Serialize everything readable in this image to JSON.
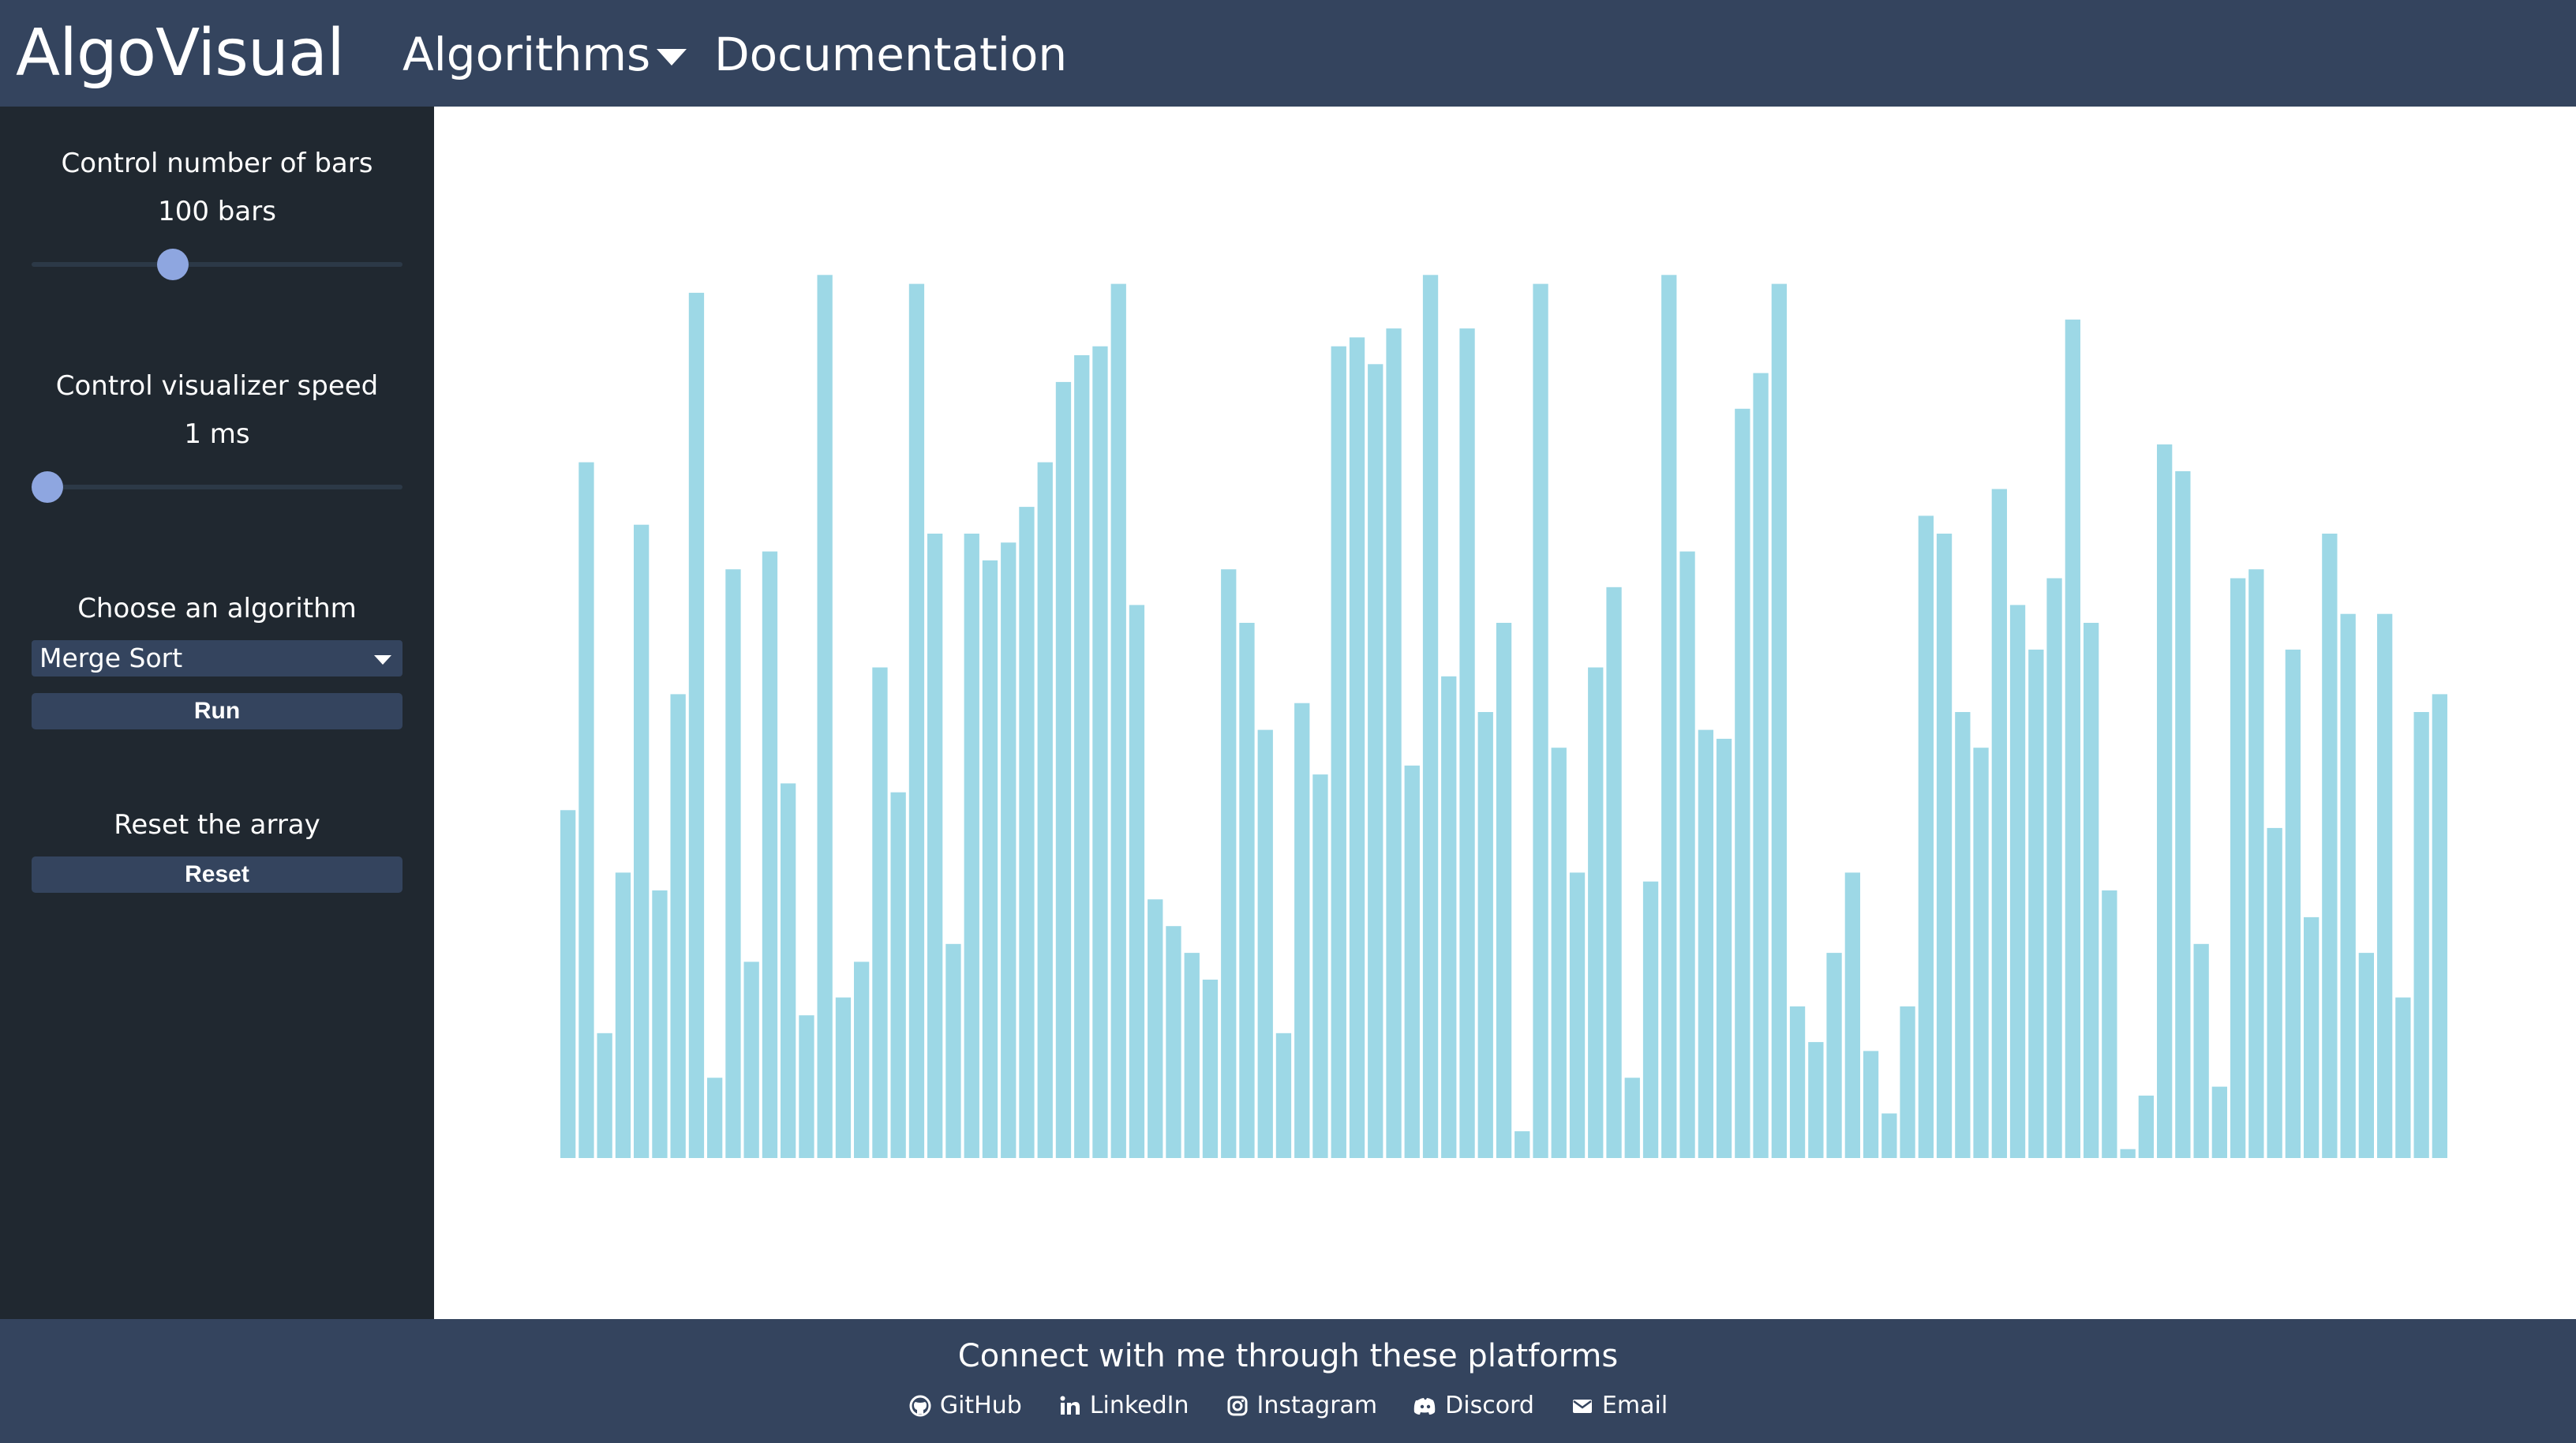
{
  "header": {
    "brand": "AlgoVisual",
    "nav": {
      "algorithms": "Algorithms",
      "documentation": "Documentation"
    }
  },
  "sidebar": {
    "bars_label": "Control number of bars",
    "bars_value": "100 bars",
    "bars_slider_fraction": 0.37,
    "speed_label": "Control visualizer speed",
    "speed_value": "1 ms",
    "speed_slider_fraction": 0.0,
    "algo_label": "Choose an algorithm",
    "algo_selected": "Merge Sort",
    "run_label": "Run",
    "reset_section_label": "Reset the array",
    "reset_label": "Reset"
  },
  "visualizer": {
    "bar_color": "#9dd8e6",
    "bar_values": [
      39,
      78,
      14,
      32,
      71,
      30,
      52,
      97,
      9,
      66,
      22,
      68,
      42,
      16,
      99,
      18,
      22,
      55,
      41,
      98,
      70,
      24,
      70,
      67,
      69,
      73,
      78,
      87,
      90,
      91,
      98,
      62,
      29,
      26,
      23,
      20,
      66,
      60,
      48,
      14,
      51,
      43,
      91,
      92,
      89,
      93,
      44,
      99,
      54,
      93,
      50,
      60,
      3,
      98,
      46,
      32,
      55,
      64,
      9,
      31,
      99,
      68,
      48,
      47,
      84,
      88,
      98,
      17,
      13,
      23,
      32,
      12,
      5,
      17,
      72,
      70,
      50,
      46,
      75,
      62,
      57,
      65,
      94,
      60,
      30,
      1,
      7,
      80,
      77,
      24,
      8,
      65,
      66,
      37,
      57,
      27,
      70,
      61,
      23,
      61,
      18,
      50,
      52
    ]
  },
  "footer": {
    "title": "Connect with me through these platforms",
    "links": [
      {
        "label": "GitHub",
        "icon": "github-icon"
      },
      {
        "label": "LinkedIn",
        "icon": "linkedin-icon"
      },
      {
        "label": "Instagram",
        "icon": "instagram-icon"
      },
      {
        "label": "Discord",
        "icon": "discord-icon"
      },
      {
        "label": "Email",
        "icon": "envelope-icon"
      }
    ]
  },
  "colors": {
    "header_bg": "#34445e",
    "sidebar_bg": "#202830",
    "slider_thumb": "#8ea6e0",
    "bar": "#9dd8e6"
  }
}
